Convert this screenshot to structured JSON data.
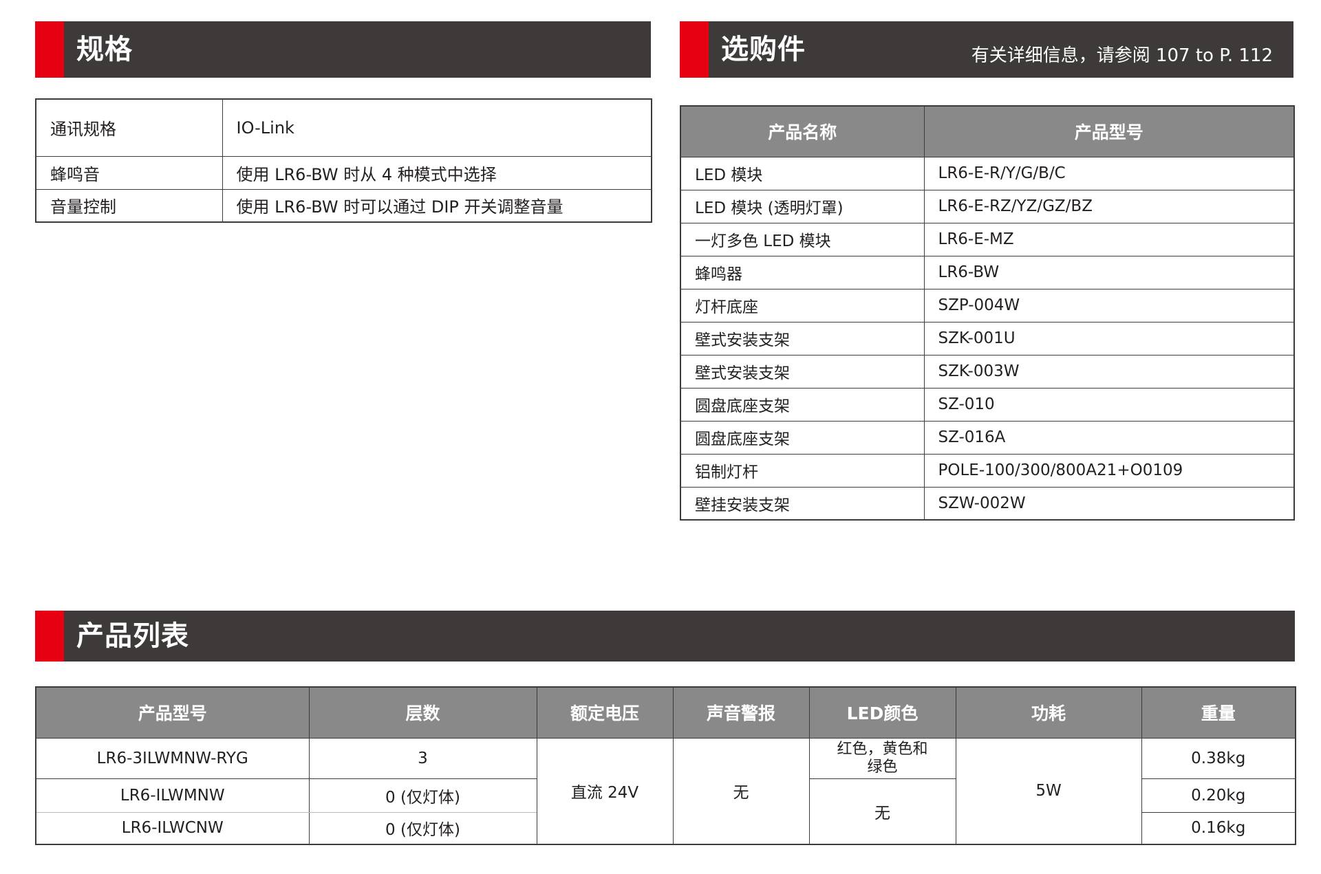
{
  "spec": {
    "title": "规格",
    "rows": [
      {
        "label": "通讯规格",
        "value": "IO-Link"
      },
      {
        "label": "蜂鸣音",
        "value": "使用 LR6-BW 时从 4 种模式中选择"
      },
      {
        "label": "音量控制",
        "value": "使用 LR6-BW 时可以通过 DIP 开关调整音量"
      }
    ]
  },
  "options": {
    "title": "选购件",
    "note": "有关详细信息，请参阅 107 to P. 112",
    "headers": [
      "产品名称",
      "产品型号"
    ],
    "rows": [
      {
        "name": "LED 模块",
        "model": "LR6-E-R/Y/G/B/C"
      },
      {
        "name": "LED 模块 (透明灯罩)",
        "model": "LR6-E-RZ/YZ/GZ/BZ"
      },
      {
        "name": "一灯多色 LED 模块",
        "model": "LR6-E-MZ"
      },
      {
        "name": "蜂鸣器",
        "model": "LR6-BW"
      },
      {
        "name": "灯杆底座",
        "model": "SZP-004W"
      },
      {
        "name": "壁式安装支架",
        "model": "SZK-001U"
      },
      {
        "name": "壁式安装支架",
        "model": "SZK-003W"
      },
      {
        "name": "圆盘底座支架",
        "model": "SZ-010"
      },
      {
        "name": "圆盘底座支架",
        "model": "SZ-016A"
      },
      {
        "name": "铝制灯杆",
        "model": "POLE-100/300/800A21+O0109"
      },
      {
        "name": "壁挂安装支架",
        "model": "SZW-002W"
      }
    ]
  },
  "products": {
    "title": "产品列表",
    "headers": [
      "产品型号",
      "层数",
      "额定电压",
      "声音警报",
      "LED颜色",
      "功耗",
      "重量"
    ],
    "rows": [
      {
        "model": "LR6-3ILWMNW-RYG",
        "tiers": "3",
        "weight": "0.38kg"
      },
      {
        "model": "LR6-ILWMNW",
        "tiers": "0 (仅灯体)",
        "weight": "0.20kg"
      },
      {
        "model": "LR6-ILWCNW",
        "tiers": "0 (仅灯体)",
        "weight": "0.16kg"
      }
    ],
    "voltage": "直流 24V",
    "alarm": "无",
    "led_color_row1": "红色，黄色和\n绿色",
    "led_color_rest": "无",
    "power": "5W"
  },
  "colors": {
    "accent": "#e60012",
    "header_bg": "#3e3a39",
    "table_header_bg": "#898989"
  }
}
